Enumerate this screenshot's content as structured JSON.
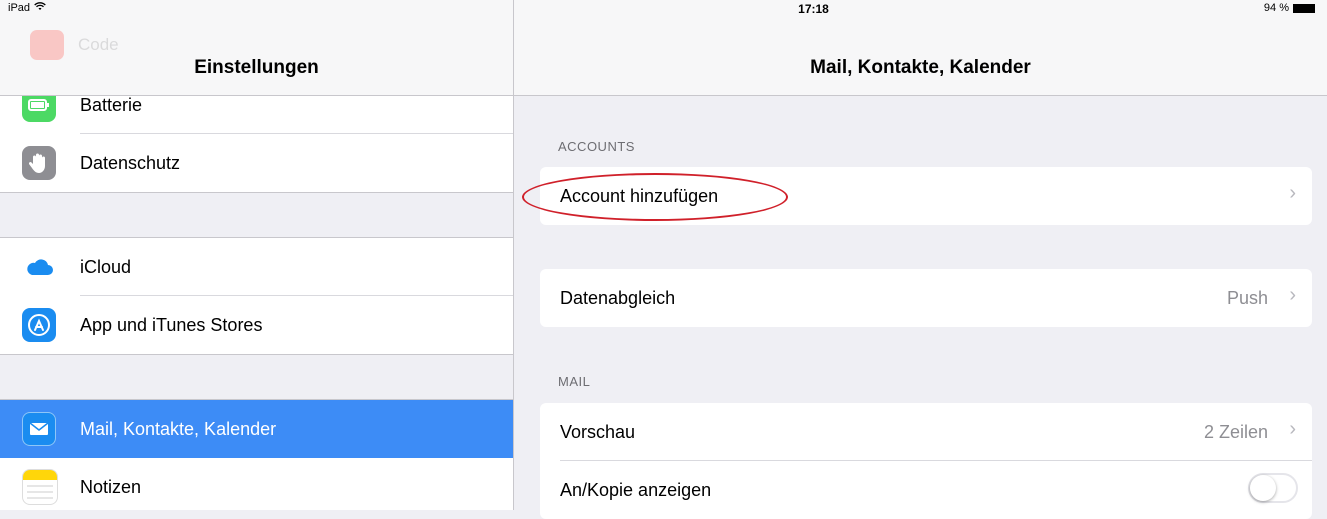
{
  "status_bar": {
    "device": "iPad",
    "time": "17:18",
    "battery": "94 %"
  },
  "sidebar": {
    "title": "Einstellungen",
    "ghost_item": "Code",
    "groups": [
      [
        {
          "label": "Batterie",
          "icon": "battery-icon",
          "color": "#4cd964"
        },
        {
          "label": "Datenschutz",
          "icon": "hand-icon",
          "color": "#8e8e93"
        }
      ],
      [
        {
          "label": "iCloud",
          "icon": "cloud-icon",
          "color": "#1a8cf0"
        },
        {
          "label": "App und iTunes Stores",
          "icon": "app-store-icon",
          "color": "#1a8cf0"
        }
      ],
      [
        {
          "label": "Mail, Kontakte, Kalender",
          "icon": "mail-icon",
          "color": "#1a8cf0",
          "selected": true
        },
        {
          "label": "Notizen",
          "icon": "notes-icon",
          "color": "#ffd60a"
        }
      ]
    ]
  },
  "detail": {
    "title": "Mail, Kontakte, Kalender",
    "sections": {
      "accounts": {
        "header": "ACCOUNTS",
        "add_account": "Account hinzufügen"
      },
      "fetch": {
        "label": "Datenabgleich",
        "value": "Push"
      },
      "mail": {
        "header": "MAIL",
        "preview_label": "Vorschau",
        "preview_value": "2 Zeilen",
        "show_to_cc_label": "An/Kopie anzeigen",
        "show_to_cc_on": false
      }
    }
  },
  "colors": {
    "accent": "#3d8cf6",
    "highlight": "#d0202a"
  }
}
